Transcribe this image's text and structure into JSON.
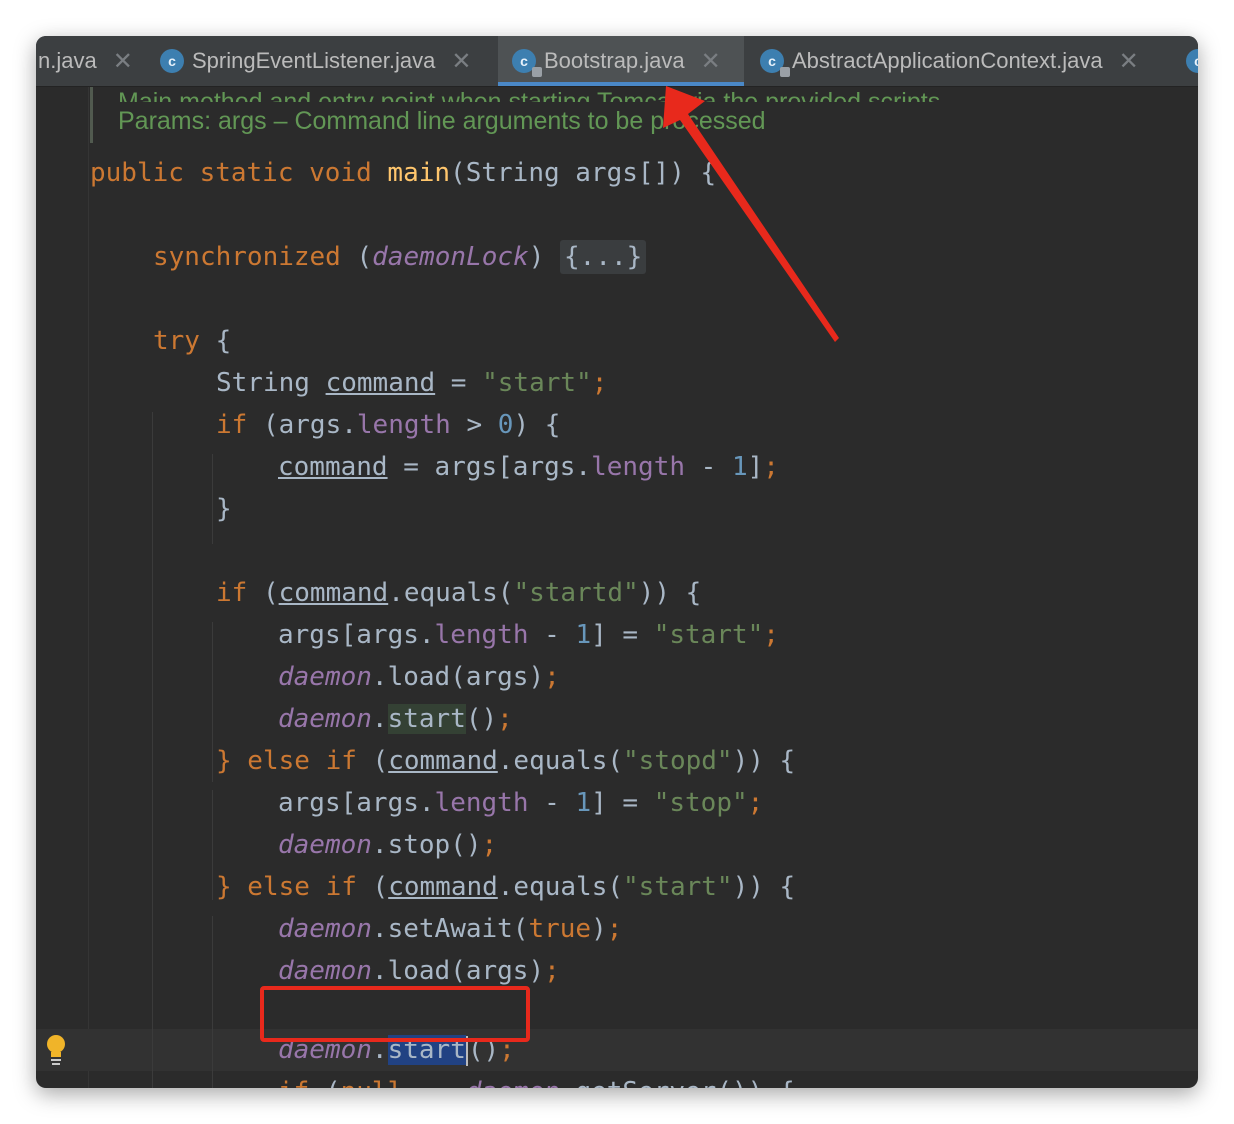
{
  "colors": {
    "keyword": "#cc7832",
    "method_decl": "#ffc66d",
    "string": "#6a8759",
    "number": "#6897bb",
    "field": "#9876aa",
    "doc_comment": "#629755",
    "default_text": "#a9b7c6",
    "editor_bg": "#2b2b2b",
    "annotation_red": "#e8291c"
  },
  "tabs": [
    {
      "label": "n.java",
      "icon": "class-icon",
      "close": "✕"
    },
    {
      "label": "SpringEventListener.java",
      "icon": "class-icon",
      "close": "✕"
    },
    {
      "label": "Bootstrap.java",
      "icon": "class-icon",
      "close": "✕",
      "active": true
    },
    {
      "label": "AbstractApplicationContext.java",
      "icon": "class-icon",
      "close": "✕"
    }
  ],
  "code": {
    "doc_partial": "Main method and entry point when starting Tomcat via the provided scripts.",
    "doc_params": "Params: args – Command line arguments to be processed",
    "sig_mod": "public static void ",
    "sig_name": "main",
    "sig_rest": "(String args[]) {",
    "sync_kw": "synchronized",
    "sync_open": " (",
    "sync_var": "daemonLock",
    "sync_close": ") ",
    "sync_fold": "{...}",
    "try_kw": "try",
    "try_brace": " {",
    "cmd_type": "String ",
    "cmd_var": "command",
    "cmd_eq": " = ",
    "cmd_val": "\"start\"",
    "semi": ";",
    "if_kw": "if",
    "if1_a": " (args.",
    "length": "length",
    "if1_b": " > ",
    "zero": "0",
    "if1_c": ") {",
    "assign_a": " = args[args.",
    "minus": " - ",
    "one": "1",
    "assign_b": "]",
    "close_brace": "}",
    "open_paren": " (",
    "equals_call": ".equals(",
    "startd_str": "\"startd\"",
    "cond_close": ")) {",
    "args_idx": "args[args.",
    "idx_close": "] = ",
    "start_str": "\"start\"",
    "stop_str": "\"stop\"",
    "daemon": "daemon",
    "load_call": ".load(args)",
    "dot": ".",
    "start_m": "start",
    "call_end": "()",
    "else_kw": "} else if",
    "stopd_str": "\"stopd\"",
    "stop_call": ".stop()",
    "setawait_a": ".setAwait(",
    "true_kw": "true",
    "paren_close": ")",
    "null_kw": "null",
    "null_eq": " == ",
    "getserver": ".getServer()) {"
  }
}
